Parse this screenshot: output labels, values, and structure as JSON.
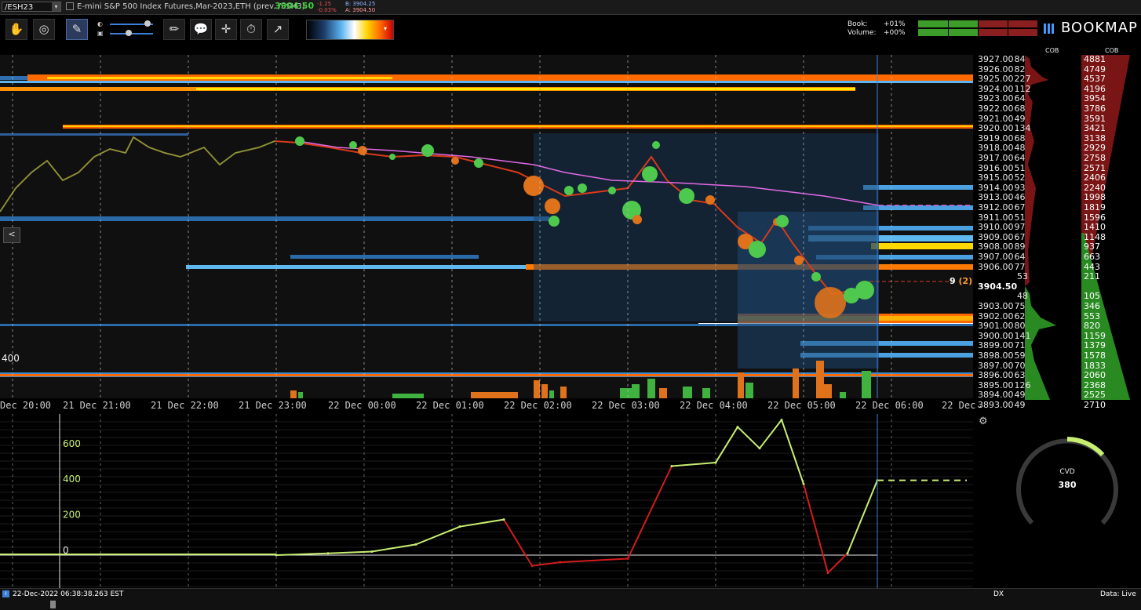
{
  "titlebar": {
    "symbol": "/ESH23",
    "description": "E-mini S&P 500 Index Futures,Mar-2023,ETH (prev. /ESH3)",
    "last_price": "3904.50",
    "change_abs": "-1.25",
    "change_pct": "-0.03%",
    "bid": "B: 3904.25",
    "ask": "A: 3904.50"
  },
  "toolbar": {
    "book_label": "Book:",
    "volume_label": "Volume:",
    "book_value": "+01%",
    "volume_value": "+00%",
    "logo_text": "BOOKMAP",
    "buttons": [
      "hand-icon",
      "target-icon",
      "cursor-icon",
      "pencil-icon",
      "chat-icon",
      "crosshair-icon",
      "stopwatch-icon",
      "chart-line-icon"
    ]
  },
  "heatmap": {
    "y_label_left": "400",
    "nav_left": "<",
    "cursor_marker": "9",
    "cursor_marker_paren": "(2)"
  },
  "price_ladder": {
    "header_cob": "COB",
    "header_cob2": "COB",
    "rows": [
      {
        "price": "3927.00",
        "size": "84",
        "cob": "4881",
        "side": "ask"
      },
      {
        "price": "3926.00",
        "size": "82",
        "cob": "4749",
        "side": "ask"
      },
      {
        "price": "3925.00",
        "size": "227",
        "cob": "4537",
        "side": "ask"
      },
      {
        "price": "3924.00",
        "size": "112",
        "cob": "4196",
        "side": "ask"
      },
      {
        "price": "3923.00",
        "size": "64",
        "cob": "3954",
        "side": "ask"
      },
      {
        "price": "3922.00",
        "size": "68",
        "cob": "3786",
        "side": "ask"
      },
      {
        "price": "3921.00",
        "size": "49",
        "cob": "3591",
        "side": "ask"
      },
      {
        "price": "3920.00",
        "size": "134",
        "cob": "3421",
        "side": "ask"
      },
      {
        "price": "3919.00",
        "size": "68",
        "cob": "3138",
        "side": "ask"
      },
      {
        "price": "3918.00",
        "size": "48",
        "cob": "2929",
        "side": "ask"
      },
      {
        "price": "3917.00",
        "size": "64",
        "cob": "2758",
        "side": "ask"
      },
      {
        "price": "3916.00",
        "size": "51",
        "cob": "2571",
        "side": "ask"
      },
      {
        "price": "3915.00",
        "size": "52",
        "cob": "2406",
        "side": "ask"
      },
      {
        "price": "3914.00",
        "size": "93",
        "cob": "2240",
        "side": "ask"
      },
      {
        "price": "3913.00",
        "size": "46",
        "cob": "1998",
        "side": "ask"
      },
      {
        "price": "3912.00",
        "size": "67",
        "cob": "1819",
        "side": "ask"
      },
      {
        "price": "3911.00",
        "size": "51",
        "cob": "1596",
        "side": "ask"
      },
      {
        "price": "3910.00",
        "size": "97",
        "cob": "1410",
        "side": "ask"
      },
      {
        "price": "3909.00",
        "size": "67",
        "cob": "1148",
        "side": "ask"
      },
      {
        "price": "3908.00",
        "size": "89",
        "cob": "937",
        "side": "ask"
      },
      {
        "price": "3907.00",
        "size": "64",
        "cob": "663",
        "side": "ask"
      },
      {
        "price": "3906.00",
        "size": "77",
        "cob": "443",
        "side": "ask"
      },
      {
        "price": "",
        "size": "53",
        "cob": "211",
        "side": "ask"
      },
      {
        "price": "3904.50",
        "size": "",
        "cob": "",
        "side": "last"
      },
      {
        "price": "",
        "size": "48",
        "cob": "105",
        "side": "bid"
      },
      {
        "price": "3903.00",
        "size": "75",
        "cob": "346",
        "side": "bid"
      },
      {
        "price": "3902.00",
        "size": "62",
        "cob": "553",
        "side": "bid"
      },
      {
        "price": "3901.00",
        "size": "80",
        "cob": "820",
        "side": "bid"
      },
      {
        "price": "3900.00",
        "size": "141",
        "cob": "1159",
        "side": "bid"
      },
      {
        "price": "3899.00",
        "size": "71",
        "cob": "1379",
        "side": "bid"
      },
      {
        "price": "3898.00",
        "size": "59",
        "cob": "1578",
        "side": "bid"
      },
      {
        "price": "3897.00",
        "size": "70",
        "cob": "1833",
        "side": "bid"
      },
      {
        "price": "3896.00",
        "size": "63",
        "cob": "2060",
        "side": "bid"
      },
      {
        "price": "3895.00",
        "size": "126",
        "cob": "2368",
        "side": "bid"
      },
      {
        "price": "3894.00",
        "size": "49",
        "cob": "2525",
        "side": "bid"
      },
      {
        "price": "3893.00",
        "size": "49",
        "cob": "2710",
        "side": "bid"
      }
    ]
  },
  "time_axis": {
    "labels": [
      "Dec 20:00",
      "21 Dec 21:00",
      "21 Dec 22:00",
      "21 Dec 23:00",
      "22 Dec 00:00",
      "22 Dec 01:00",
      "22 Dec 02:00",
      "22 Dec 03:00",
      "22 Dec 04:00",
      "22 Dec 05:00",
      "22 Dec 06:00",
      "22 Dec"
    ]
  },
  "cvd": {
    "y_ticks": [
      "600",
      "400",
      "200",
      "0"
    ],
    "gauge_label": "CVD",
    "gauge_value": "380"
  },
  "status": {
    "timestamp": "22-Dec-2022 06:38:38.263 EST",
    "dx": "DX",
    "data": "Data: Live"
  },
  "chart_data": {
    "type": "line",
    "title": "",
    "xlabel": "",
    "ylabel": "",
    "ylim": [
      -100,
      800
    ],
    "grid": true,
    "x": [
      "21 Dec 23:00",
      "22 Dec 00:00",
      "22 Dec 00:30",
      "22 Dec 01:00",
      "22 Dec 01:30",
      "22 Dec 02:00",
      "22 Dec 02:15",
      "22 Dec 02:30",
      "22 Dec 03:00",
      "22 Dec 03:30",
      "22 Dec 04:00",
      "22 Dec 04:15",
      "22 Dec 04:30",
      "22 Dec 04:45",
      "22 Dec 05:00",
      "22 Dec 05:15",
      "22 Dec 05:30",
      "22 Dec 06:00"
    ],
    "series": [
      {
        "values": [
          0,
          10,
          20,
          60,
          160,
          200,
          -60,
          -40,
          -20,
          500,
          520,
          720,
          600,
          760,
          400,
          -100,
          10,
          420
        ]
      }
    ]
  }
}
